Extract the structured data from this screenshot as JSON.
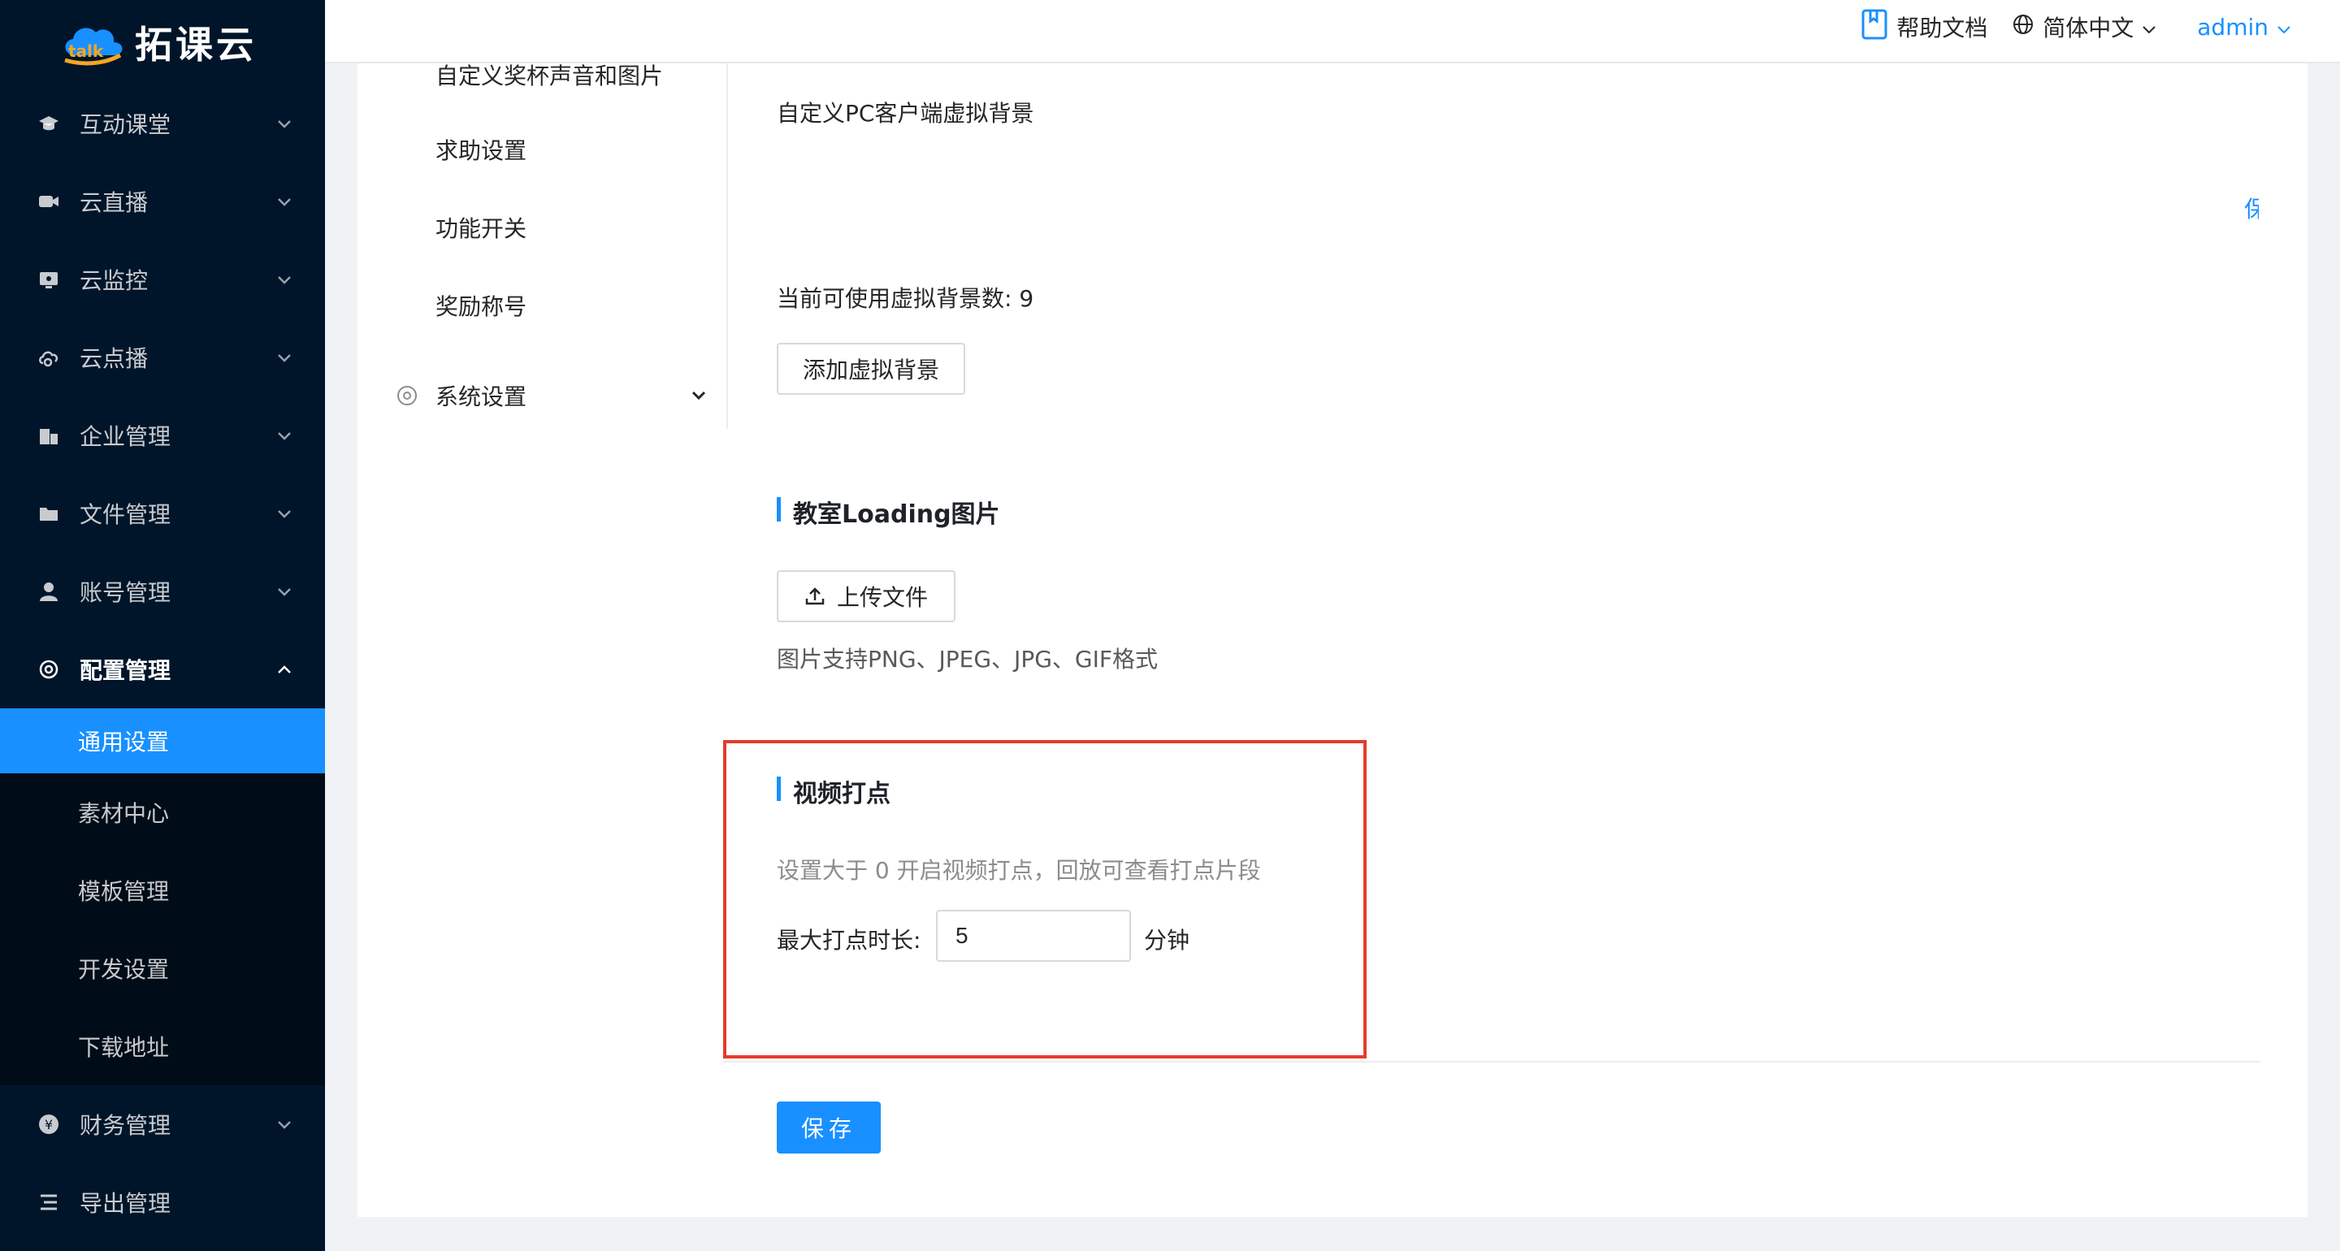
{
  "brand": {
    "name": "拓课云",
    "logo_text": "talk"
  },
  "sidebar": {
    "items": [
      {
        "label": "互动课堂",
        "icon": "graduation-cap-icon"
      },
      {
        "label": "云直播",
        "icon": "video-camera-icon"
      },
      {
        "label": "云监控",
        "icon": "monitor-eye-icon"
      },
      {
        "label": "云点播",
        "icon": "cloud-play-icon"
      },
      {
        "label": "企业管理",
        "icon": "building-icon"
      },
      {
        "label": "文件管理",
        "icon": "folder-icon"
      },
      {
        "label": "账号管理",
        "icon": "user-icon"
      },
      {
        "label": "配置管理",
        "icon": "gear-icon"
      }
    ],
    "config_sub": [
      {
        "label": "通用设置"
      },
      {
        "label": "素材中心"
      },
      {
        "label": "模板管理"
      },
      {
        "label": "开发设置"
      },
      {
        "label": "下载地址"
      }
    ],
    "after": [
      {
        "label": "财务管理",
        "icon": "yen-icon"
      },
      {
        "label": "导出管理",
        "icon": "export-list-icon"
      }
    ]
  },
  "topbar": {
    "help": "帮助文档",
    "language": "简体中文",
    "user": "admin"
  },
  "inner_menu": {
    "items": [
      "自定义奖杯声音和图片",
      "求助设置",
      "功能开关",
      "奖励称号"
    ],
    "system": "系统设置"
  },
  "main": {
    "vbg_title": "自定义PC客户端虚拟背景",
    "vbg_count": "当前可使用虚拟背景数: 9",
    "add_vbg": "添加虚拟背景",
    "edge_char": "保",
    "loading_title": "教室Loading图片",
    "upload": "上传文件",
    "upload_hint": "图片支持PNG、JPEG、JPG、GIF格式",
    "mark_title": "视频打点",
    "mark_hint": "设置大于 0 开启视频打点，回放可查看打点片段",
    "mark_label": "最大打点时长:",
    "mark_value": "5",
    "mark_unit": "分钟",
    "save": "保存"
  },
  "colors": {
    "sidebar_bg": "#001529",
    "accent": "#1890ff",
    "highlight": "#e43b2c"
  }
}
